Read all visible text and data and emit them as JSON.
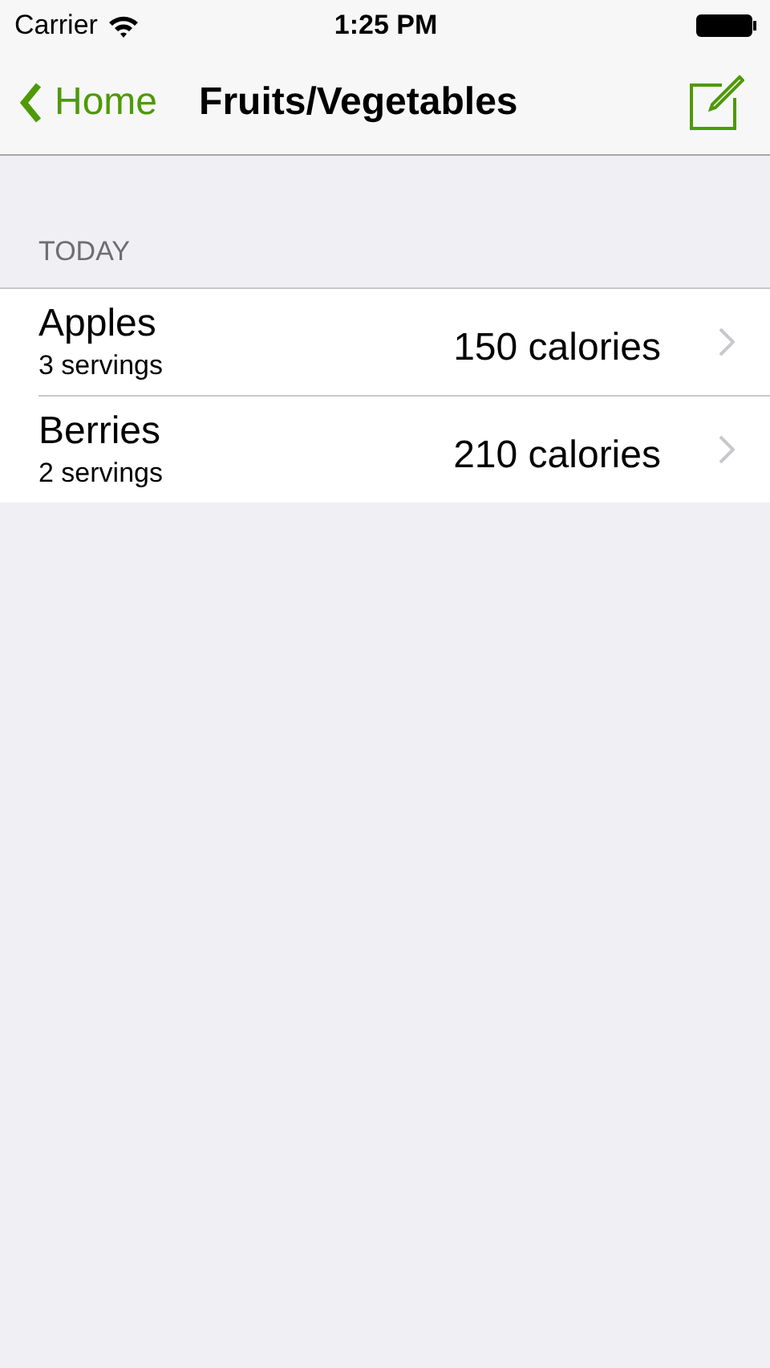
{
  "status_bar": {
    "carrier": "Carrier",
    "time": "1:25 PM"
  },
  "nav_bar": {
    "back": "Home",
    "title": "Fruits/Vegetables"
  },
  "section": {
    "header": "TODAY",
    "rows": [
      {
        "name": "Apples",
        "servings": "3 servings",
        "calories": "150 calories"
      },
      {
        "name": "Berries",
        "servings": "2 servings",
        "calories": "210 calories"
      }
    ]
  }
}
